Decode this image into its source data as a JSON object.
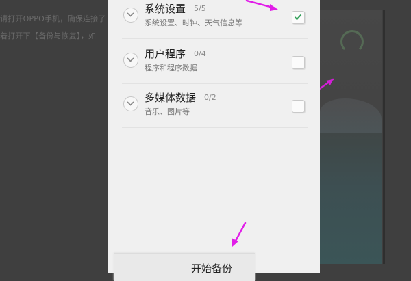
{
  "background": {
    "line1": "请打开OPPO手机，确保连接了",
    "line2": "着打开下【备份与恢复】，如"
  },
  "items": [
    {
      "title": "系统设置",
      "count": "5/5",
      "subtitle": "系统设置、时钟、天气信息等",
      "checked": true
    },
    {
      "title": "用户程序",
      "count": "0/4",
      "subtitle": "程序和程序数据",
      "checked": false
    },
    {
      "title": "多媒体数据",
      "count": "0/2",
      "subtitle": "音乐、图片等",
      "checked": false
    }
  ],
  "start_button": {
    "label": "开始备份"
  },
  "colors": {
    "accent_check": "#2e9e55",
    "annotation_arrow": "#e11ee8"
  }
}
